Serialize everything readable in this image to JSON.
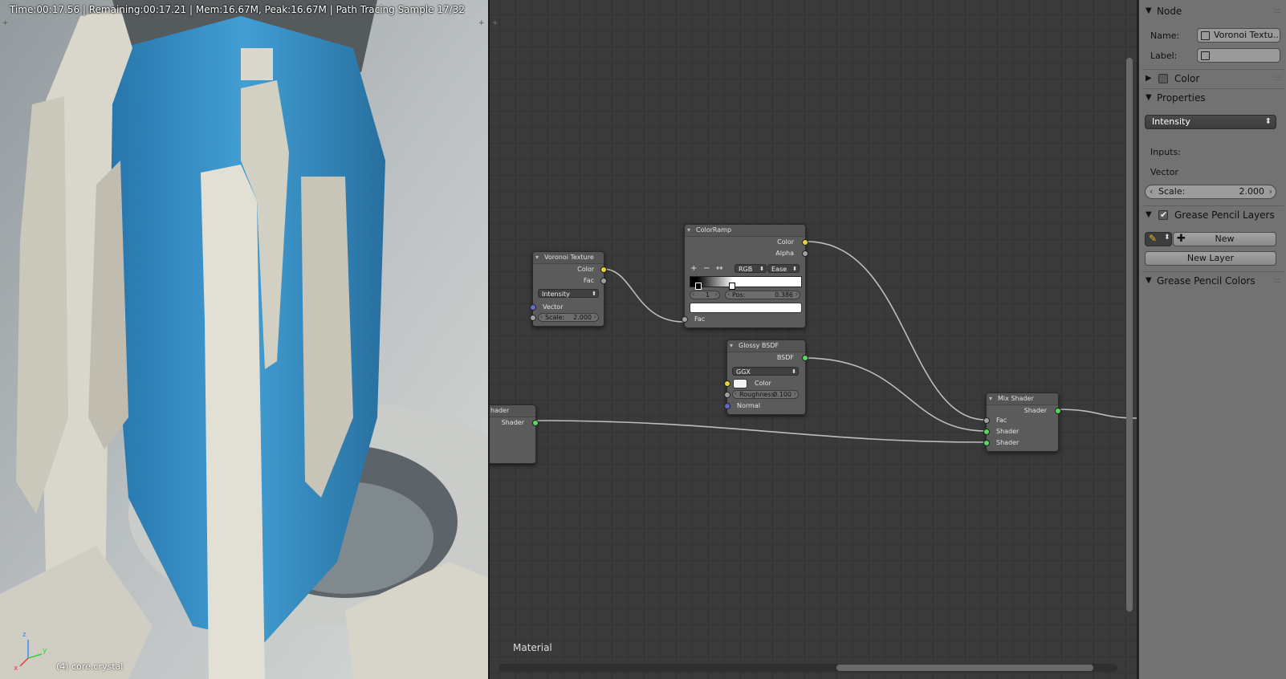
{
  "viewport": {
    "status_text": "Time:00:17.56 | Remaining:00:17.21 | Mem:16.67M, Peak:16.67M | Path Tracing Sample 17/32",
    "object_label": "(4) core.crystal",
    "axes": {
      "z": "z",
      "y": "y",
      "x": "x"
    }
  },
  "node_editor": {
    "tree_label": "Material",
    "nodes": {
      "voronoi": {
        "title": "Voronoi Texture",
        "out_color": "Color",
        "out_fac": "Fac",
        "coloring": "Intensity",
        "in_vector": "Vector",
        "scale_label": "Scale:",
        "scale_value": "2.000"
      },
      "colorramp": {
        "title": "ColorRamp",
        "out_color": "Color",
        "out_alpha": "Alpha",
        "add": "+",
        "remove": "−",
        "flip": "↔",
        "mode": "RGB",
        "interp": "Ease",
        "stop_index": "1",
        "pos_label": "Pos:",
        "pos_value": "0.386",
        "in_fac": "Fac"
      },
      "glossy": {
        "title": "Glossy BSDF",
        "out_bsdf": "BSDF",
        "distribution": "GGX",
        "color_label": "Color",
        "roughness_label": "Roughness:",
        "roughness_value": "0.100",
        "normal_label": "Normal"
      },
      "mix": {
        "title": "Mix Shader",
        "out_shader": "Shader",
        "in_fac": "Fac",
        "in_shader1": "Shader",
        "in_shader2": "Shader"
      },
      "partial": {
        "title": "hader",
        "out_shader": "Shader"
      }
    }
  },
  "properties": {
    "node_panel": {
      "title": "Node",
      "name_label": "Name:",
      "name_value": "Voronoi Textu...",
      "label_label": "Label:",
      "label_value": ""
    },
    "color_panel": {
      "title": "Color"
    },
    "properties_panel": {
      "title": "Properties",
      "coloring": "Intensity",
      "inputs_label": "Inputs:",
      "vector_label": "Vector",
      "scale_label": "Scale:",
      "scale_value": "2.000"
    },
    "gp_layers_panel": {
      "title": "Grease Pencil Layers",
      "new_button": "New",
      "new_layer_button": "New Layer"
    },
    "gp_colors_panel": {
      "title": "Grease Pencil Colors"
    }
  },
  "colors": {
    "socket_color": "#e8d23a",
    "socket_float": "#a1a1a1",
    "socket_shader": "#5cd65c",
    "socket_vector": "#6767d6",
    "crystal_blue": "#3a8fc4"
  }
}
